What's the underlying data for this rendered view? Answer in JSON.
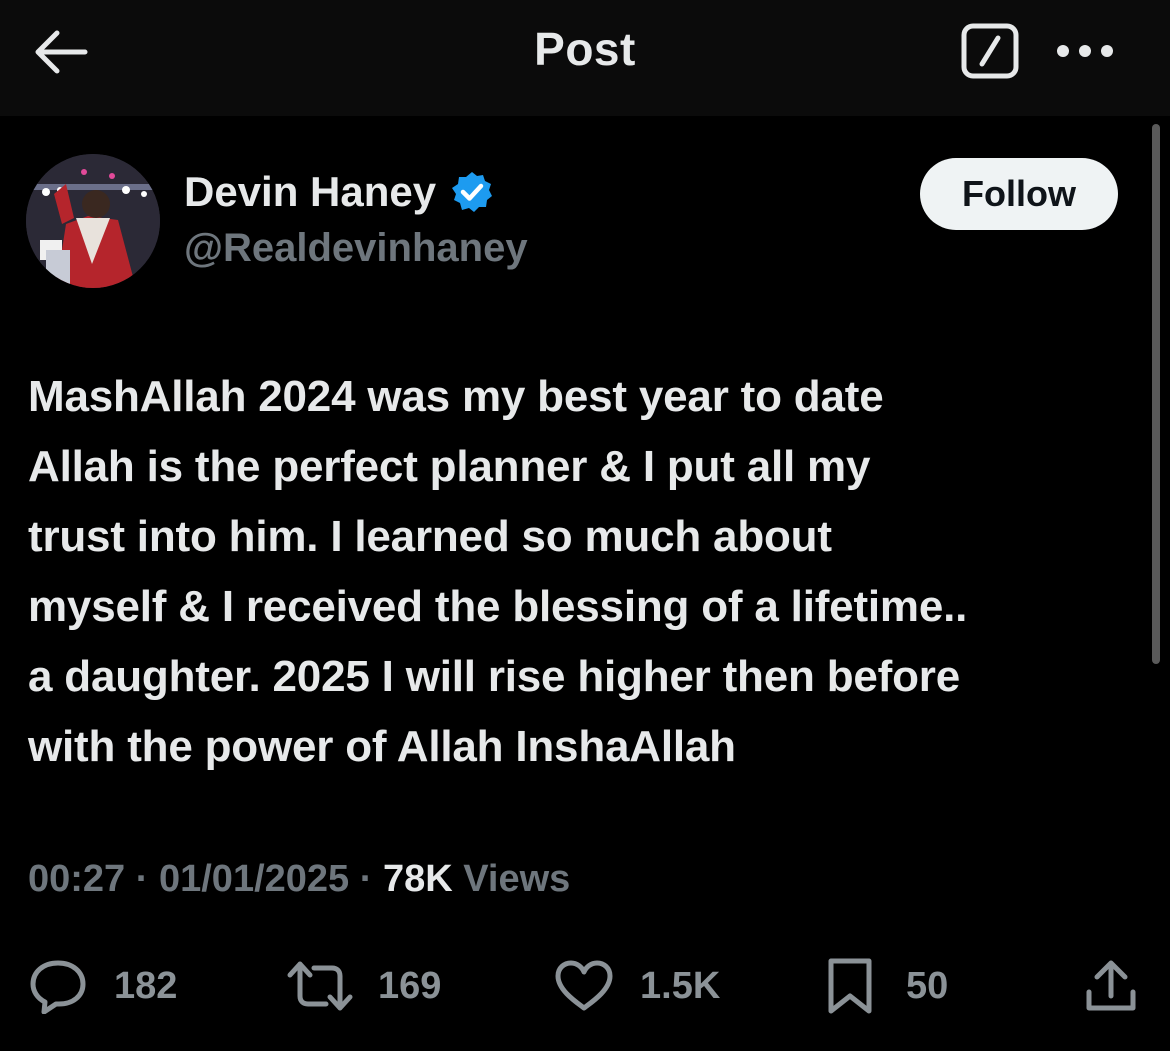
{
  "header": {
    "title": "Post",
    "back_icon": "arrow-left-icon",
    "compose_icon": "compose-edit-icon",
    "more_icon": "more-dots-icon"
  },
  "author": {
    "name": "Devin Haney",
    "handle": "@Realdevinhaney",
    "verified": true,
    "verified_color": "#1d9bf0",
    "follow_label": "Follow"
  },
  "post": {
    "text": "MashAllah 2024 was my best year to date\nAllah is the perfect planner & I put all my\ntrust into him.  I learned so much about\nmyself & I received the blessing of a lifetime..\na daughter. 2025 I will rise higher then before\nwith the power of Allah InshaAllah",
    "time": "00:27",
    "date": "01/01/2025",
    "views_count": "78K",
    "views_label": "Views",
    "separator": "·"
  },
  "actions": {
    "replies": "182",
    "reposts": "169",
    "likes": "1.5K",
    "bookmarks": "50"
  },
  "colors": {
    "background": "#000000",
    "header_bg": "#0b0b0b",
    "text_primary": "#e7e9ea",
    "text_secondary": "#6e767d",
    "follow_bg": "#eff3f4"
  }
}
